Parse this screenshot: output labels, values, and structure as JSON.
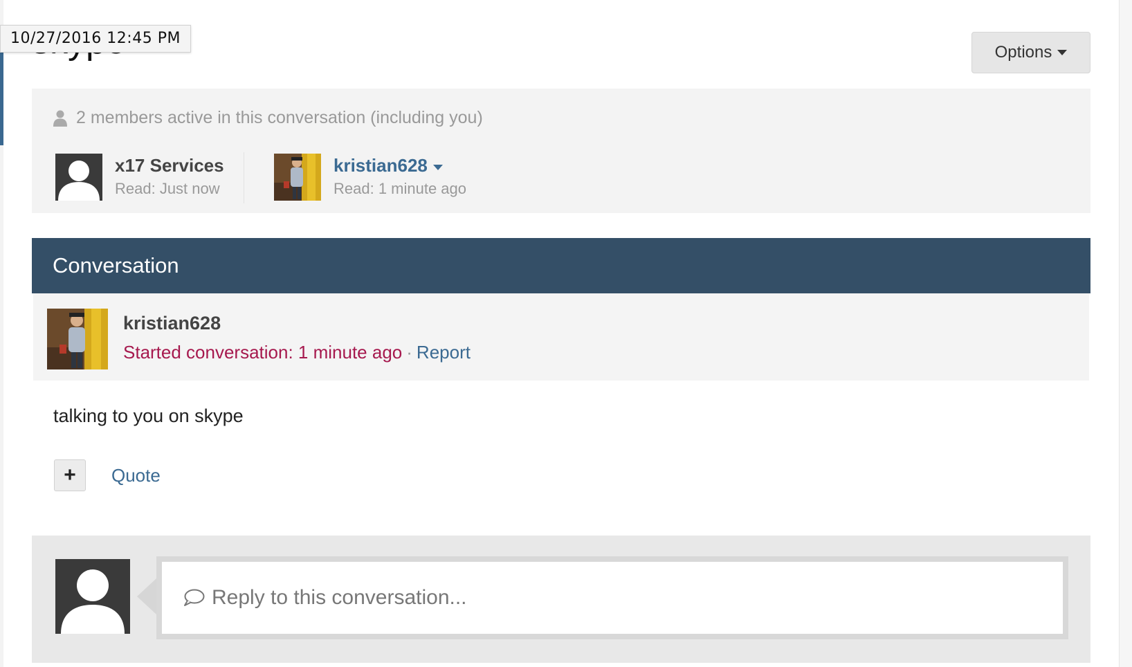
{
  "tooltip": {
    "timestamp": "10/27/2016 12:45  PM"
  },
  "page": {
    "title": "skype"
  },
  "options_button": {
    "label": "Options"
  },
  "members": {
    "heading": "2 members active in this conversation (including you)",
    "list": [
      {
        "name": "x17 Services",
        "read": "Read: Just now"
      },
      {
        "name": "kristian628",
        "read": "Read: 1 minute ago"
      }
    ]
  },
  "conversation": {
    "header": "Conversation",
    "message": {
      "author": "kristian628",
      "started": "Started conversation: 1 minute ago",
      "separator": "·",
      "report": "Report",
      "body": "talking to you on skype",
      "plus": "+",
      "quote": "Quote"
    }
  },
  "reply": {
    "placeholder": "Reply to this conversation..."
  },
  "colors": {
    "header_bg": "#344f67",
    "link": "#3b6a92",
    "started": "#a6194e"
  }
}
